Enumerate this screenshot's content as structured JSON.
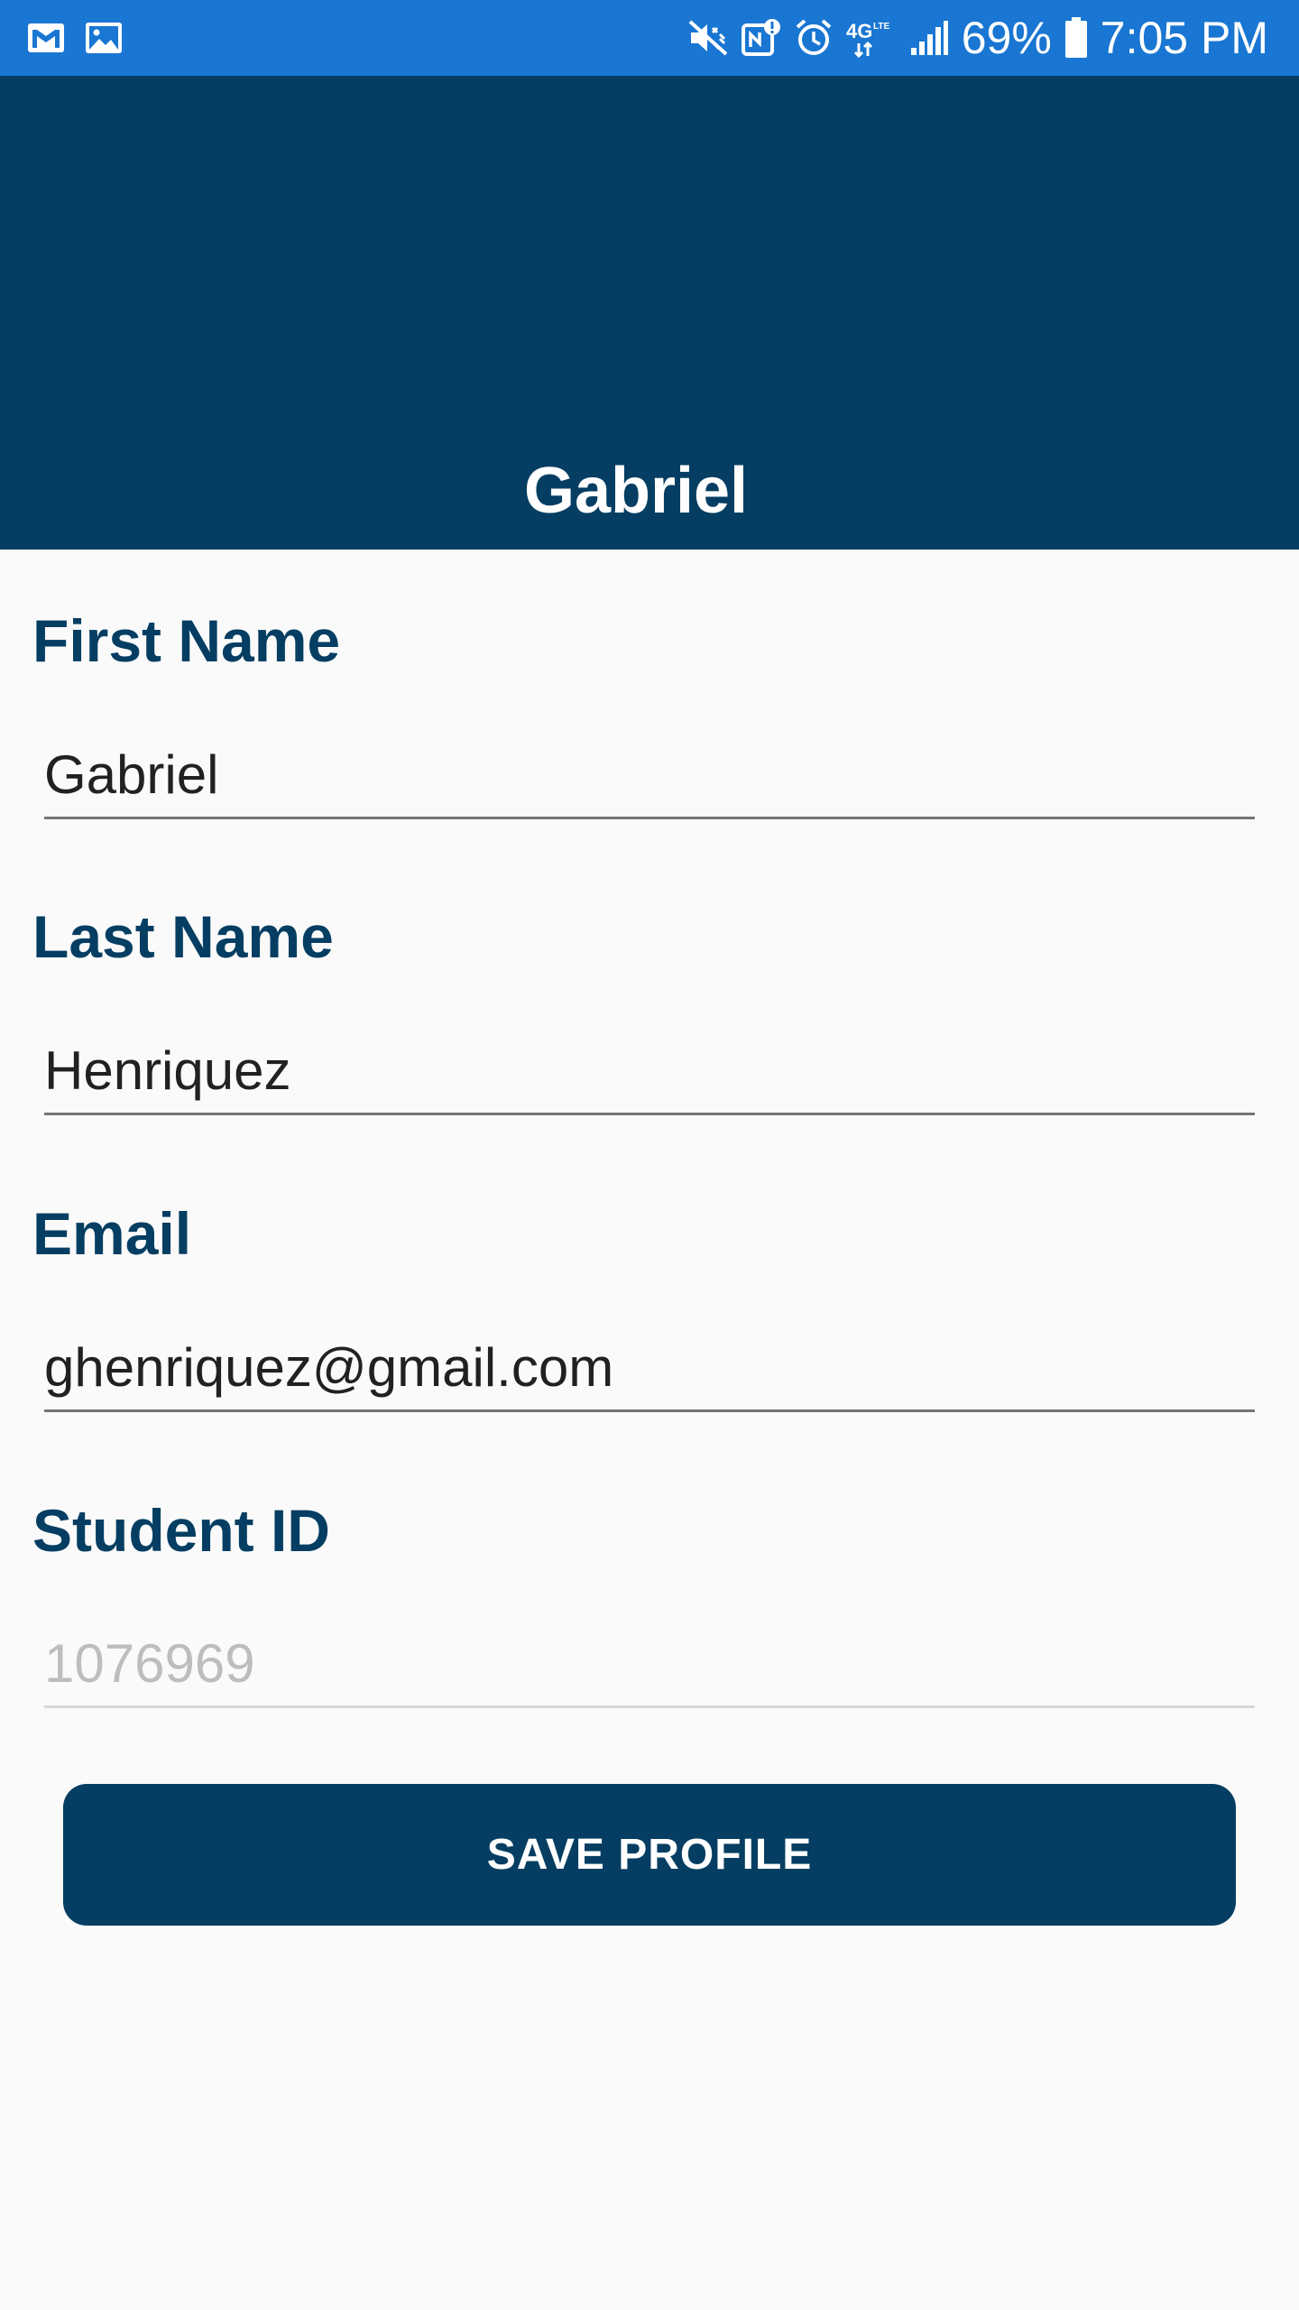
{
  "status_bar": {
    "left_icons": [
      "gmail-icon",
      "gallery-icon"
    ],
    "right_icons": [
      "mute-icon",
      "nfc-icon",
      "alarm-icon",
      "4g-lte-icon",
      "signal-icon"
    ],
    "battery_percent": "69%",
    "battery_icon": "battery-icon",
    "time": "7:05 PM",
    "color": "#1976d2"
  },
  "header": {
    "name": "Gabriel",
    "background": "#053e62"
  },
  "form": {
    "first_name": {
      "label": "First Name",
      "value": "Gabriel"
    },
    "last_name": {
      "label": "Last Name",
      "value": "Henriquez"
    },
    "email": {
      "label": "Email",
      "value": "ghenriquez@gmail.com"
    },
    "student_id": {
      "label": "Student ID",
      "value": "1076969",
      "disabled": true
    }
  },
  "save_button": {
    "label": "SAVE PROFILE"
  },
  "colors": {
    "primary": "#053e62",
    "status_bar": "#1976d2",
    "background": "#fafafa"
  }
}
